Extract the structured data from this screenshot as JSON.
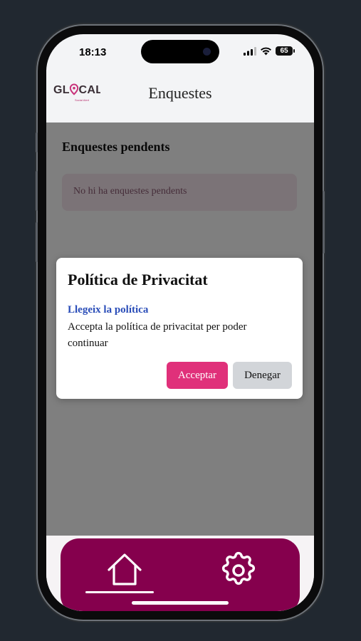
{
  "status_bar": {
    "time": "18:13",
    "battery": "65"
  },
  "header": {
    "logo": "GLOCAL",
    "logo_tagline": "Social Alert",
    "title": "Enquestes"
  },
  "main": {
    "section_title": "Enquestes pendents",
    "empty_message": "No hi ha enquestes pendents"
  },
  "modal": {
    "title": "Política de Privacitat",
    "link": "Llegeix la política",
    "text": "Accepta la política de privacitat per poder continuar",
    "accept_label": "Acceptar",
    "deny_label": "Denegar"
  },
  "tab_bar": {
    "items": [
      {
        "icon": "home-icon",
        "active": true
      },
      {
        "icon": "gear-icon",
        "active": false
      }
    ]
  },
  "colors": {
    "brand": "#85004d",
    "accent": "#e0307a",
    "link": "#2a4db8",
    "device_background": "#212830"
  }
}
